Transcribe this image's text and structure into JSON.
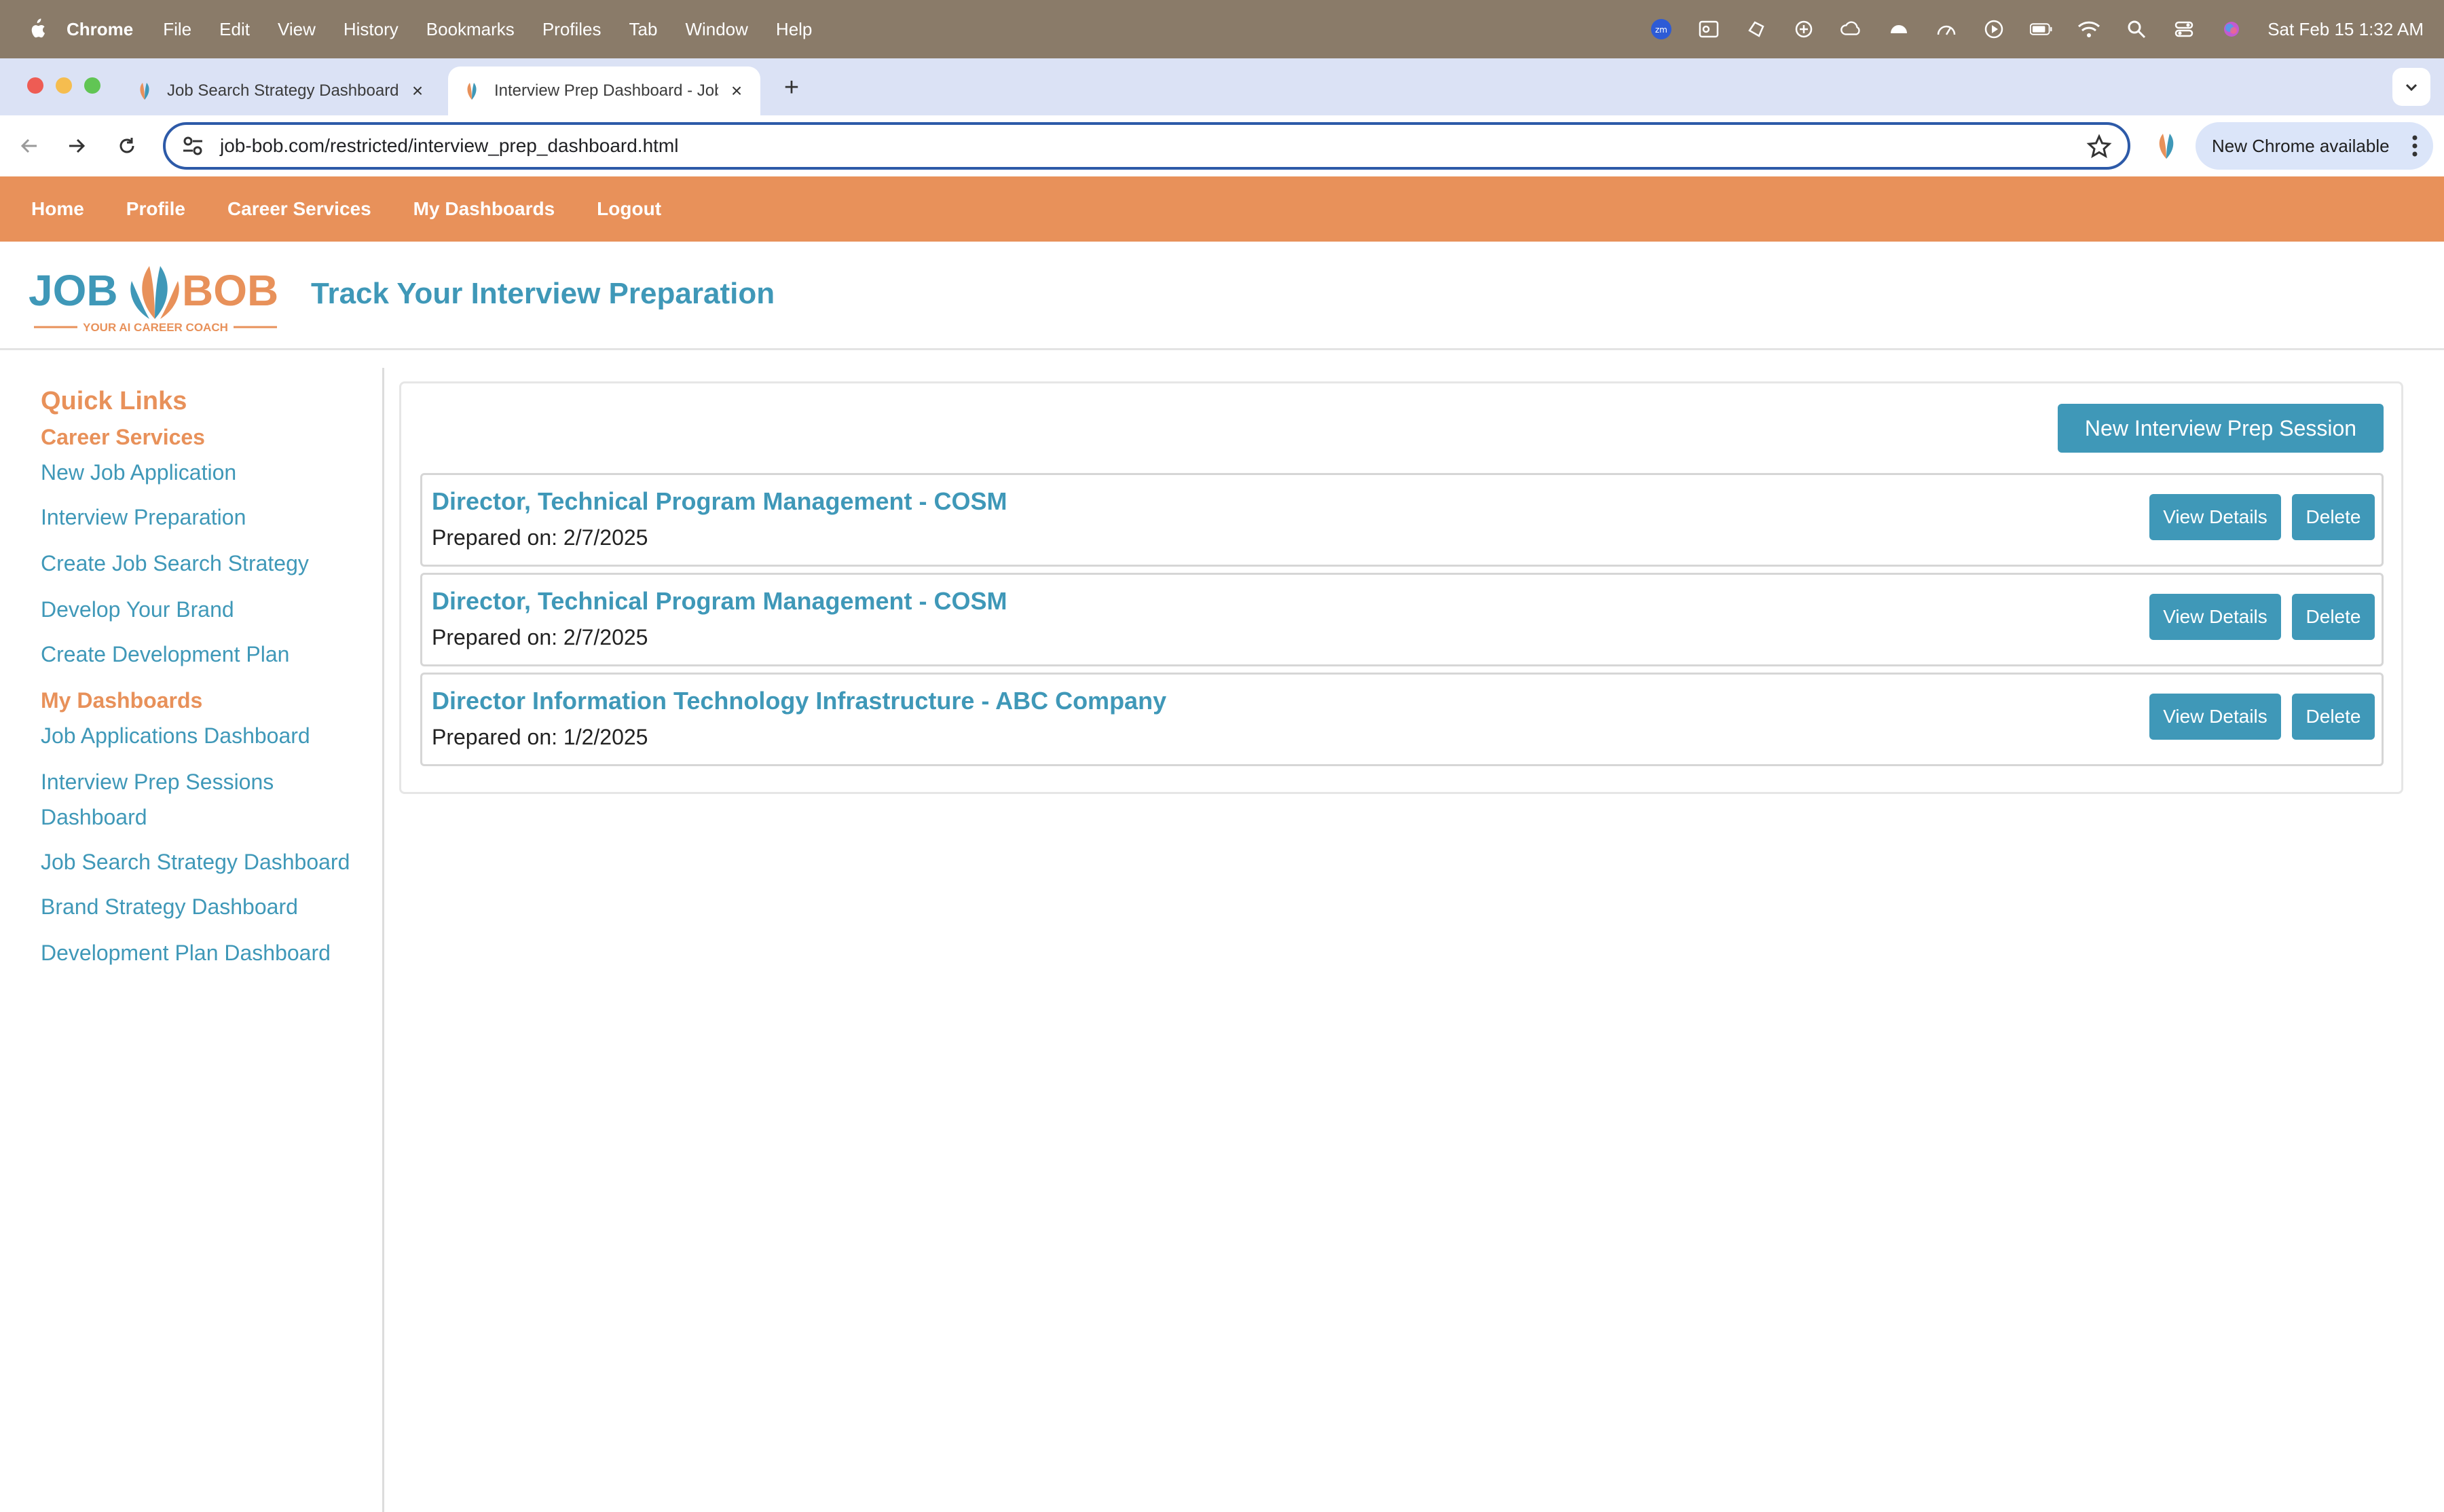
{
  "menubar": {
    "app_name": "Chrome",
    "items": [
      "File",
      "Edit",
      "View",
      "History",
      "Bookmarks",
      "Profiles",
      "Tab",
      "Window",
      "Help"
    ],
    "clock": "Sat Feb 15  1:32 AM",
    "status_icons": [
      "zoom-icon",
      "outlook-icon",
      "hand-icon",
      "cloud-sync-icon",
      "cloud-icon",
      "weather-icon",
      "gauge-icon",
      "play-icon",
      "battery-icon",
      "wifi-icon",
      "spotlight-icon",
      "control-center-icon",
      "siri-icon"
    ]
  },
  "browser": {
    "tabs": [
      {
        "title": "Job Search Strategy Dashboard"
      },
      {
        "title": "Interview Prep Dashboard - Job Bob"
      }
    ],
    "url": "job-bob.com/restricted/interview_prep_dashboard.html",
    "update_label": "New Chrome available"
  },
  "site": {
    "nav": [
      "Home",
      "Profile",
      "Career Services",
      "My Dashboards",
      "Logout"
    ],
    "logo": {
      "left": "JOB",
      "right": "BOB",
      "tagline": "YOUR AI CAREER COACH"
    },
    "page_title": "Track Your Interview Preparation"
  },
  "sidebar": {
    "heading": "Quick Links",
    "career_services": {
      "title": "Career Services",
      "links": [
        "New Job Application",
        "Interview Preparation",
        "Create Job Search Strategy",
        "Develop Your Brand",
        "Create Development Plan"
      ]
    },
    "dashboards": {
      "title": "My Dashboards",
      "links": [
        "Job Applications Dashboard",
        "Interview Prep Sessions Dashboard",
        "Job Search Strategy Dashboard",
        "Brand Strategy Dashboard",
        "Development Plan Dashboard"
      ]
    }
  },
  "main": {
    "new_session_label": "New Interview Prep Session",
    "sessions": [
      {
        "title": "Director, Technical Program Management - COSM",
        "prepared": "Prepared on: 2/7/2025"
      },
      {
        "title": "Director, Technical Program Management - COSM",
        "prepared": "Prepared on: 2/7/2025"
      },
      {
        "title": "Director Information Technology Infrastructure - ABC Company",
        "prepared": "Prepared on: 1/2/2025"
      }
    ],
    "view_label": "View Details",
    "delete_label": "Delete"
  },
  "colors": {
    "brand_orange": "#e8915a",
    "brand_teal": "#3f98b8"
  }
}
